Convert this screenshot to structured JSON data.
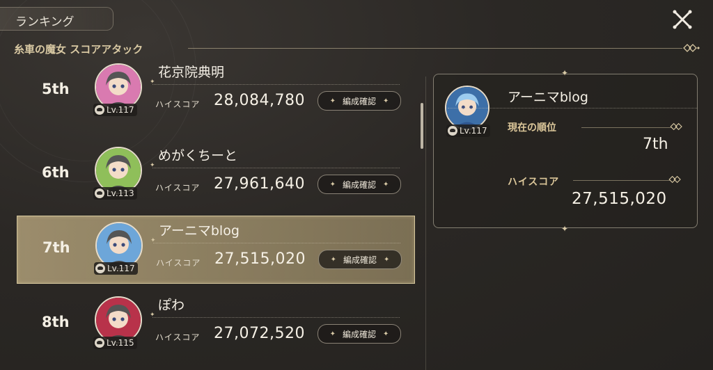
{
  "header": {
    "tab_title": "ランキング",
    "subtitle": "糸車の魔女 スコアアタック"
  },
  "ranking": [
    {
      "rank": "5th",
      "name": "花京院典明",
      "level": "Lv.117",
      "score_label": "ハイスコア",
      "score": "28,084,780",
      "button": "編成確認",
      "avatar_color": "#d97ab0",
      "highlight": false
    },
    {
      "rank": "6th",
      "name": "めがくちーと",
      "level": "Lv.113",
      "score_label": "ハイスコア",
      "score": "27,961,640",
      "button": "編成確認",
      "avatar_color": "#8fbf5a",
      "highlight": false
    },
    {
      "rank": "7th",
      "name": "アーニマblog",
      "level": "Lv.117",
      "score_label": "ハイスコア",
      "score": "27,515,020",
      "button": "編成確認",
      "avatar_color": "#6da6d9",
      "highlight": true
    },
    {
      "rank": "8th",
      "name": "ぽわ",
      "level": "Lv.115",
      "score_label": "ハイスコア",
      "score": "27,072,520",
      "button": "編成確認",
      "avatar_color": "#b8324a",
      "highlight": false
    }
  ],
  "detail": {
    "name": "アーニマblog",
    "level": "Lv.117",
    "rank_label": "現在の順位",
    "rank": "7th",
    "score_label": "ハイスコア",
    "score": "27,515,020",
    "avatar_color": "#6da6d9"
  },
  "icons": {
    "close": "close-cross-icon",
    "level": "helmet-icon",
    "ornament": "diamond-ornament-icon"
  },
  "colors": {
    "accent_gold": "#d9c9a3",
    "highlight_row": "#af9e78",
    "background": "#2b2825"
  }
}
